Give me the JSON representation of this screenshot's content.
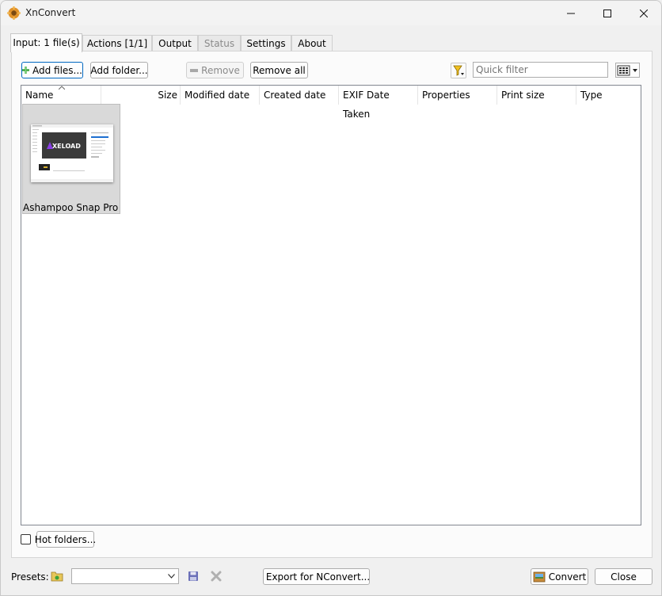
{
  "window": {
    "title": "XnConvert",
    "minimize_icon": "minimize-icon",
    "maximize_icon": "maximize-icon",
    "close_icon": "close-icon"
  },
  "tabs": [
    {
      "label": "Input: 1 file(s)",
      "state": "active"
    },
    {
      "label": "Actions [1/1]",
      "state": "normal"
    },
    {
      "label": "Output",
      "state": "normal"
    },
    {
      "label": "Status",
      "state": "disabled"
    },
    {
      "label": "Settings",
      "state": "normal"
    },
    {
      "label": "About",
      "state": "normal"
    }
  ],
  "toolbar": {
    "add_files": "Add files...",
    "add_folder": "Add folder...",
    "remove": "Remove",
    "remove_all": "Remove all",
    "quick_filter_placeholder": "Quick filter"
  },
  "columns": [
    "Name",
    "Size",
    "Modified date",
    "Created date",
    "EXIF Date Taken",
    "Properties",
    "Print size",
    "Type"
  ],
  "files": [
    {
      "name": "Ashampoo Snap Pro S...",
      "thumbnail_text": "XELOAD"
    }
  ],
  "bottom": {
    "hot_folders": "Hot folders...",
    "presets_label": "Presets:",
    "preset_value": "",
    "export_label": "Export for NConvert...",
    "convert_label": "Convert",
    "close_label": "Close"
  },
  "colors": {
    "accent": "#0067c0",
    "thumb_bg": "#3a3a3a",
    "logo_purple": "#8a3ee6"
  }
}
